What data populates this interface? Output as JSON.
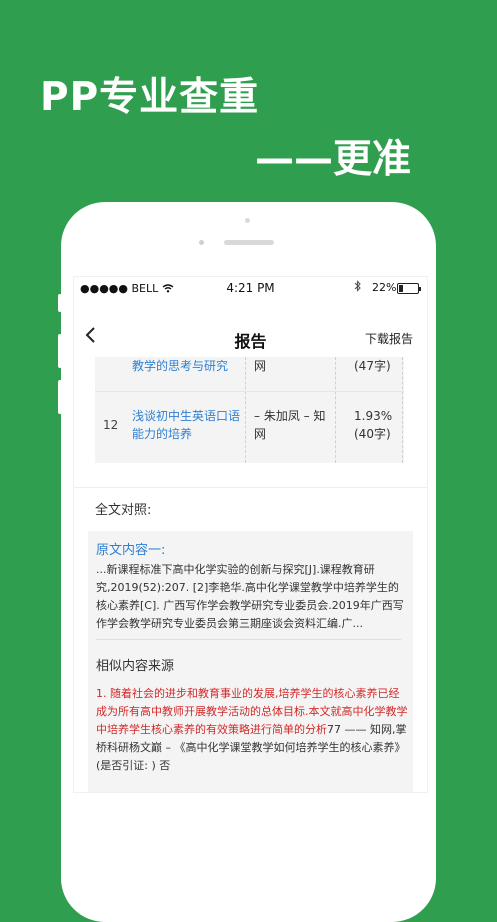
{
  "hero": {
    "title": "PP专业查重",
    "subtitle": "——更准"
  },
  "status_bar": {
    "carrier": "●●●●● BELL ",
    "wifi_icon": "wifi-icon",
    "time": "4:21 PM",
    "bluetooth_icon": "bluetooth-icon",
    "battery": "22%",
    "battery_level_percent": 22
  },
  "nav": {
    "back_icon": "‹",
    "title": "报告",
    "download": "下载报告"
  },
  "table": {
    "rows": [
      {
        "num": "",
        "title": "教学的思考与研究",
        "author": "网",
        "rate": "(47字)"
      },
      {
        "num": "12",
        "title": "浅谈初中生英语口语能力的培养",
        "author": "– 朱加凤 – 知网",
        "rate": "1.93% (40字)"
      }
    ]
  },
  "compare": {
    "section_label": "全文对照:",
    "original_heading": "原文内容一:",
    "original_text": "...新课程标准下高中化学实验的创新与探究[J].课程教育研究,2019(52):207. [2]李艳华.高中化学课堂教学中培养学生的核心素养[C]. 广西写作学会教学研究专业委员会.2019年广西写作学会教学研究专业委员会第三期座谈会资料汇编.广...",
    "similar_heading": "相似内容来源",
    "similar_red": "1. 随着社会的进步和教育事业的发展,培养学生的核心素养已经成为所有高中教师开展教学活动的总体目标.本文就高中化学教学中培养学生核心素养的有效策略进行简单的分析",
    "similar_rest": "77 —— 知网,掌桥科研杨文巅 – 《高中化学课堂教学如何培养学生的核心素养》 (是否引证: ) 否"
  },
  "colors": {
    "background": "#2f9e4f",
    "link_blue": "#2f7fd1",
    "highlight_red": "#d12a2a"
  }
}
